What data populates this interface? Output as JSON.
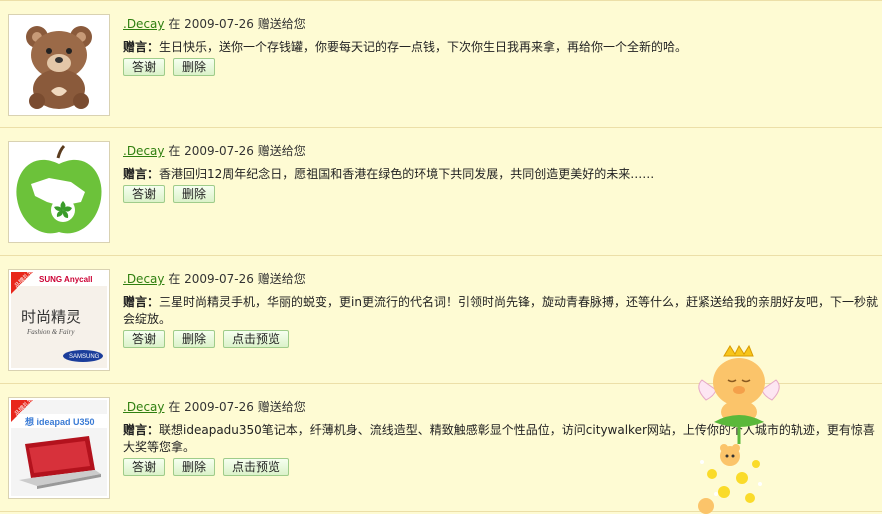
{
  "gifts": [
    {
      "sender": ".Decay",
      "date_text": "在 2009-07-26 赠送给您",
      "msg_label": "赠言：",
      "msg": "生日快乐，送你一个存钱罐，你要每天记的存一点钱，下次你生日我再来拿，再给你一个全新的哈。",
      "buttons": [
        "答谢",
        "删除"
      ],
      "image": "teddy-bear-icon"
    },
    {
      "sender": ".Decay",
      "date_text": "在 2009-07-26 赠送给您",
      "msg_label": "赠言：",
      "msg": "香港回归12周年纪念日，愿祖国和香港在绿色的环境下共同发展，共同创造更美好的未来……",
      "buttons": [
        "答谢",
        "删除"
      ],
      "image": "green-apple-icon"
    },
    {
      "sender": ".Decay",
      "date_text": "在 2009-07-26 赠送给您",
      "msg_label": "赠言：",
      "msg": "三星时尚精灵手机，华丽的蜕变，更in更流行的代名词！引领时尚先锋，旋动青春脉搏，还等什么，赶紧送给我的亲朋好友吧，下一秒就会绽放。",
      "buttons": [
        "答谢",
        "删除",
        "点击预览"
      ],
      "image": "samsung-phone-ad",
      "image_text": {
        "badge": "品牌礼物",
        "brand": "SUNG Anycall",
        "title": "时尚精灵",
        "sub": "Fashion & Fairy",
        "logo": "SAMSUNG"
      }
    },
    {
      "sender": ".Decay",
      "date_text": "在 2009-07-26 赠送给您",
      "msg_label": "赠言：",
      "msg": "联想ideapadu350笔记本，纤薄机身、流线造型、精致触感彰显个性品位，访问citywalker网站，上传你的个人城市的轨迹，更有惊喜大奖等您拿。",
      "buttons": [
        "答谢",
        "删除",
        "点击预览"
      ],
      "image": "lenovo-laptop-ad",
      "image_text": {
        "badge": "品牌礼物",
        "brand": "想 ideapad U350"
      }
    }
  ],
  "colors": {
    "background": "#fefbd3",
    "link": "#2f7f10",
    "button_bg": "#dbf2c9"
  },
  "mascot": "angel-pig-mascot"
}
